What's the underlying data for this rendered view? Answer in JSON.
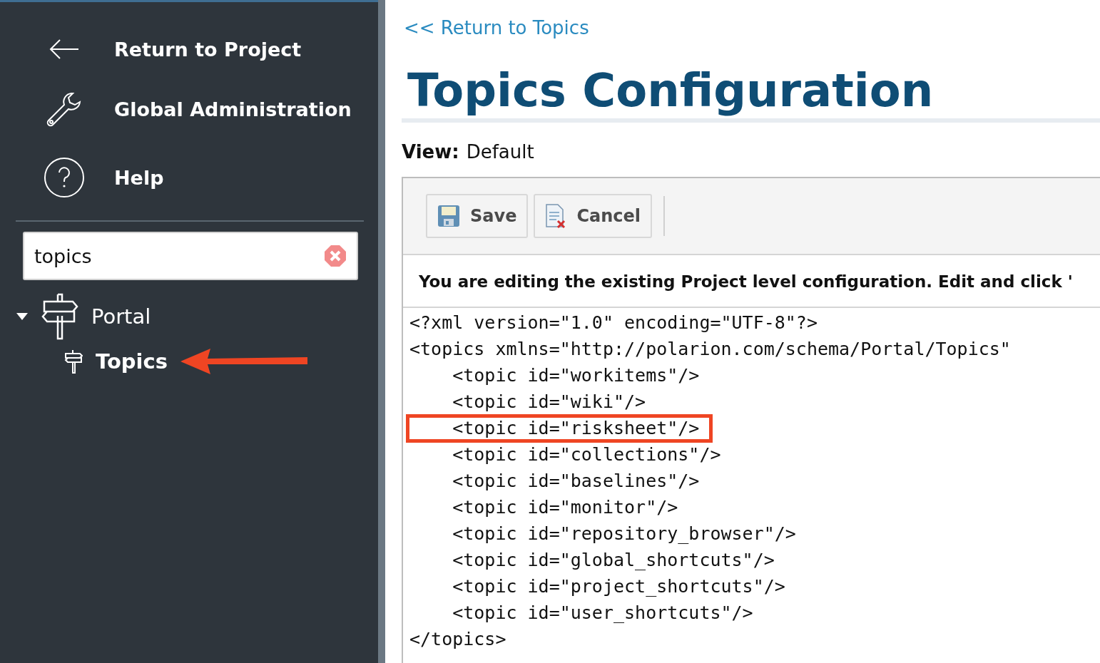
{
  "sidebar": {
    "nav_items": [
      {
        "label": "Return to Project",
        "kind": "back"
      },
      {
        "label": "Global Administration",
        "kind": "wrench"
      },
      {
        "label": "Help",
        "kind": "help"
      }
    ],
    "search": {
      "value": "topics"
    },
    "tree": [
      {
        "label": "Portal",
        "expanded": true,
        "selected": false,
        "children": [
          {
            "label": "Topics",
            "selected": true
          }
        ]
      }
    ]
  },
  "main": {
    "back_link": "<< Return to Topics",
    "title": "Topics Configuration",
    "view_label": "View:",
    "view_value": "Default",
    "toolbar": [
      {
        "label": "Save",
        "kind": "save"
      },
      {
        "label": "Cancel",
        "kind": "cancel"
      }
    ],
    "notice": "You are editing the existing Project level configuration. Edit and click '",
    "code_lines": [
      {
        "text": "<?xml version=\"1.0\" encoding=\"UTF-8\"?>",
        "highlighted": false
      },
      {
        "text": "<topics xmlns=\"http://polarion.com/schema/Portal/Topics\"",
        "highlighted": false
      },
      {
        "text": "    <topic id=\"workitems\"/>",
        "highlighted": false
      },
      {
        "text": "    <topic id=\"wiki\"/>",
        "highlighted": false
      },
      {
        "text": "    <topic id=\"risksheet\"/>",
        "highlighted": true
      },
      {
        "text": "    <topic id=\"collections\"/>",
        "highlighted": false
      },
      {
        "text": "    <topic id=\"baselines\"/>",
        "highlighted": false
      },
      {
        "text": "    <topic id=\"monitor\"/>",
        "highlighted": false
      },
      {
        "text": "    <topic id=\"repository_browser\"/>",
        "highlighted": false
      },
      {
        "text": "    <topic id=\"global_shortcuts\"/>",
        "highlighted": false
      },
      {
        "text": "    <topic id=\"project_shortcuts\"/>",
        "highlighted": false
      },
      {
        "text": "    <topic id=\"user_shortcuts\"/>",
        "highlighted": false
      },
      {
        "text": "</topics>",
        "highlighted": false
      }
    ]
  }
}
